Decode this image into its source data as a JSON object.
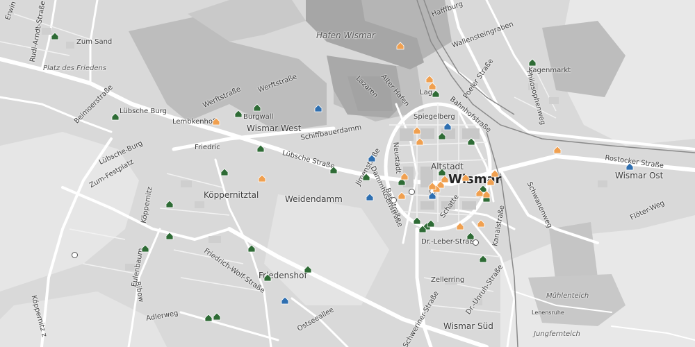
{
  "map": {
    "labels": {
      "hafen_wismar": "Hafen Wismar",
      "hafffburg": "Hafffburg",
      "wallensteingraben": "Wallensteingraben",
      "kagenmarkt": "Kagenmarkt",
      "philosophenweg": "Philosophenweg",
      "poeler_strasse": "Poeler Straße",
      "lubsche_burg": "Lübsche Burg",
      "burgwall": "Burgwall",
      "lembkenhof": "Lembkenhof",
      "wismar_west": "Wismar West",
      "werftstrasse": "Werftstraße",
      "werftstrasse2": "Werftstraße",
      "schiffbauerdamm": "Schiffbauerdamm",
      "lubsche_strasse": "Lübsche Straße",
      "friedric": "Friedric",
      "koppernitztal": "Köppernitztal",
      "weidendamm": "Weidendamm",
      "altstadt": "Altstadt",
      "wismar": "Wismar",
      "spiegelberg": "Spiegelberg",
      "bahnhofstrasse": "Bahnhofstraße",
      "rostocker_strasse": "Rostocker Straße",
      "wismar_ost": "Wismar Ost",
      "flotter_weg": "Flöter-Weg",
      "schwanenweg": "Schwanenweg",
      "friedenshof": "Friedenshof",
      "muhlenteich": "Mühlenteich",
      "lenensruhe": "Lenensruhe",
      "jungfernteich": "Jungfernteich",
      "wismar_sud": "Wismar Süd",
      "dr_leber_strasse": "Dr.-Leber-Straße",
      "kanalstrasse": "Kanalstraße",
      "platz_des_friedens": "Platz des Friedens",
      "zum_sandring": "Zum Sand",
      "zum_festplatz": "Zum-Festplatz",
      "lubsche_burg2": "Lübsche-Burg",
      "beimoerstrasse": "Beimoerstraße",
      "dammhusenstrasse": "Dammhusenstraße",
      "baustrasse": "Baustraße",
      "neustadt": "Neustadt",
      "jimenstrasse": "Jimenstraße",
      "koppernitz": "Köppernitz",
      "adlerweg": "Adlerweg",
      "bibowstrasse": "Bibow",
      "eulenbaum": "Eulenbaum",
      "friedrich_wolf": "Friedrich-Wolf-Straße",
      "ostseeallee": "Ostseeallee",
      "schweriner_strasse": "Schweriner-Straße",
      "dr_unruh": "Dr.-Unruh-Straße",
      "zellerring": "Zellerring",
      "rudolf_arndt": "Rudi-Arndt-Straße",
      "erwin": "Erwin",
      "alter_hafen": "Alter Hafen",
      "lazaren": "Lazaren",
      "lagerhaus": "Lag",
      "koppernitz_z": "Köppernitz z",
      "schatten": "Schatte"
    },
    "colors": {
      "background": "#d9d9d9",
      "water": "#a6a6a6",
      "road": "#ffffff",
      "green_marker": "#2e6b35",
      "orange_marker": "#f0a050",
      "blue_marker": "#2f6fb0"
    },
    "icons": {
      "green": "house-icon-green",
      "orange": "house-icon-orange",
      "blue": "house-icon-blue",
      "poi": "poi-circle-icon"
    }
  }
}
